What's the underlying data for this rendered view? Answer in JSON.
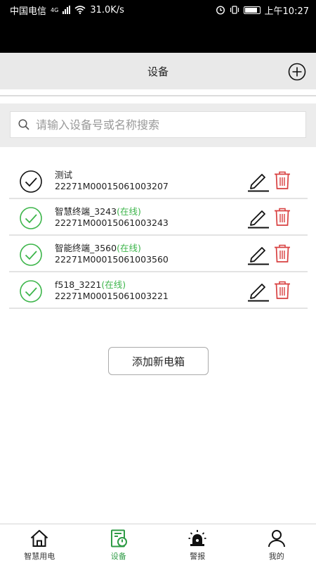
{
  "status_bar": {
    "carrier": "中国电信",
    "network": "4G",
    "speed": "31.0K/s",
    "time": "上午10:27"
  },
  "header": {
    "title": "设备"
  },
  "search": {
    "placeholder": "请输入设备号或名称搜索",
    "value": ""
  },
  "devices": [
    {
      "name": "测试",
      "status": "",
      "id": "22271M00015061003207",
      "online": false
    },
    {
      "name": "智慧终端_3243",
      "status": "(在线)",
      "id": "22271M00015061003243",
      "online": true
    },
    {
      "name": "智能终端_3560",
      "status": "(在线)",
      "id": "22271M00015061003560",
      "online": true
    },
    {
      "name": "f518_3221",
      "status": "(在线)",
      "id": "22271M00015061003221",
      "online": true
    }
  ],
  "add_button": {
    "label": "添加新电箱"
  },
  "bottom_nav": {
    "items": [
      {
        "label": "智慧用电",
        "icon": "home-icon",
        "active": false
      },
      {
        "label": "设备",
        "icon": "device-icon",
        "active": true
      },
      {
        "label": "警报",
        "icon": "alarm-icon",
        "active": false
      },
      {
        "label": "我的",
        "icon": "user-icon",
        "active": false
      }
    ]
  },
  "colors": {
    "online": "#3cb54a",
    "delete": "#d84040",
    "active_nav": "#2e9b45",
    "header_bg": "#e9e9e9"
  }
}
